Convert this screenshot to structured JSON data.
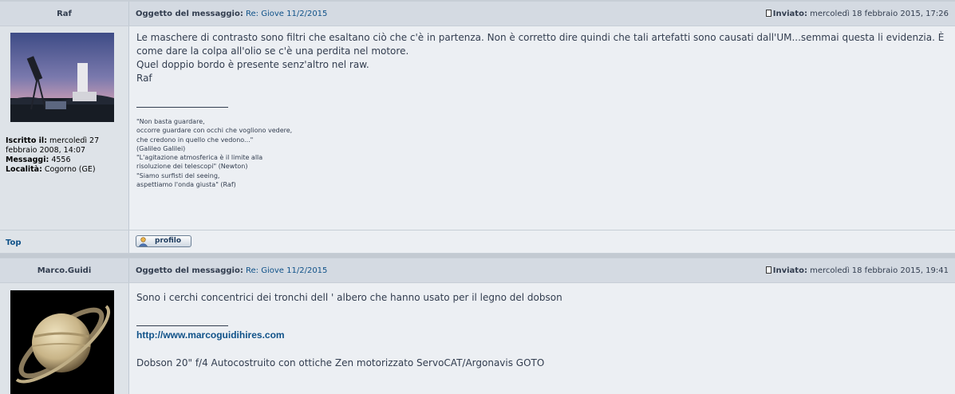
{
  "posts": [
    {
      "author": "Raf",
      "subject_label": "Oggetto del messaggio:",
      "subject": "Re: Giove 11/2/2015",
      "posted_label": "Inviato:",
      "posted": "mercoledì 18 febbraio 2015, 17:26",
      "avatar_icon": "telescope-twilight-photo",
      "user_info": {
        "joined_label": "Iscritto il:",
        "joined": "mercoledì 27 febbraio 2008, 14:07",
        "messages_label": "Messaggi:",
        "messages": "4556",
        "location_label": "Località:",
        "location": "Cogorno (GE)"
      },
      "body_lines": [
        "Le maschere di contrasto sono filtri che esaltano ciò che c'è in partenza. Non è corretto dire quindi che tali artefatti sono causati dall'UM...semmai questa li evidenzia. È",
        "come dare la colpa all'olio se c'è una perdita nel motore.",
        "Quel doppio bordo è presente senz'altro nel raw.",
        "Raf"
      ],
      "signature_lines": [
        "\"Non basta guardare,",
        "occorre guardare con occhi che vogliono vedere,",
        "che credono in quello che vedono...\"",
        "(Galileo Galilei)",
        "\"L'agitazione atmosferica è il limite alla",
        "risoluzione dei telescopi\" (Newton)",
        "\"Siamo surfisti del seeing,",
        "aspettiamo l'onda giusta\" (Raf)"
      ],
      "top_label": "Top",
      "profile_label": "profilo"
    },
    {
      "author": "Marco.Guidi",
      "subject_label": "Oggetto del messaggio:",
      "subject": "Re: Giove 11/2/2015",
      "posted_label": "Inviato:",
      "posted": "mercoledì 18 febbraio 2015, 19:41",
      "avatar_icon": "saturn-photo",
      "body_lines": [
        "Sono i cerchi concentrici dei tronchi dell ' albero che hanno usato per il legno del dobson"
      ],
      "signature_link": "http://www.marcoguidihires.com",
      "signature_text": "Dobson 20\" f/4 Autocostruito con ottiche Zen motorizzato ServoCAT/Argonavis GOTO"
    }
  ],
  "colors": {
    "link": "#105289",
    "text": "#323d4f",
    "header_bg": "#d4dae2",
    "body_bg": "#eceff3",
    "sidebar_bg": "#dee3e8"
  }
}
